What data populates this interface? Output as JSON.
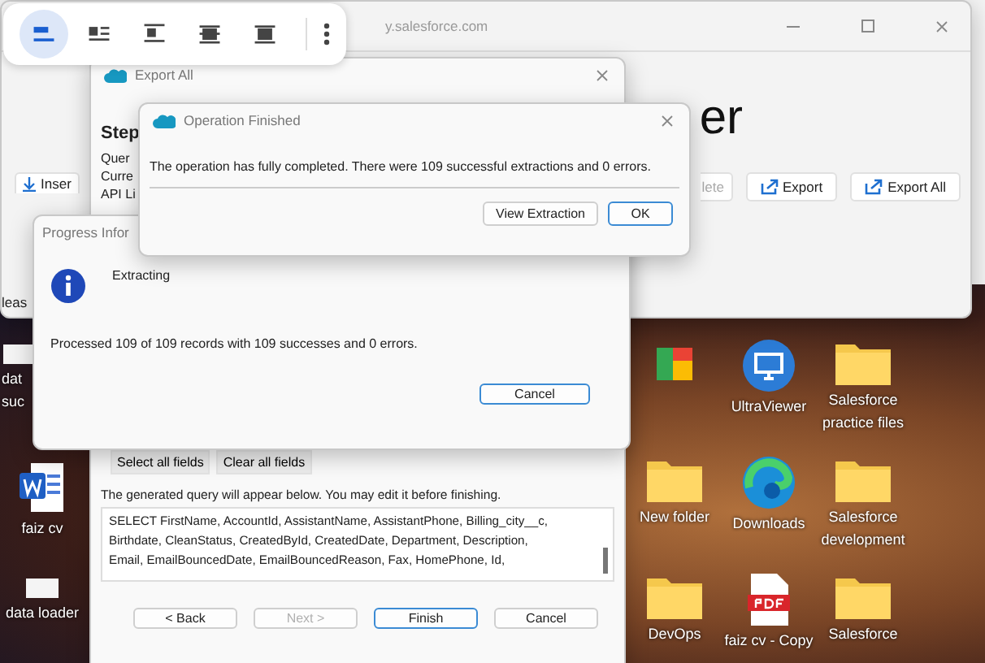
{
  "toolbar": {
    "buttons": [
      {
        "kind": "inline",
        "selected": true
      },
      {
        "kind": "square",
        "selected": false
      },
      {
        "kind": "top-bottom",
        "selected": false
      },
      {
        "kind": "behind",
        "selected": false
      },
      {
        "kind": "front",
        "selected": false
      }
    ]
  },
  "main_window": {
    "url": "y.salesforce.com",
    "heading": "er",
    "left_button": "Inser",
    "note": "leas",
    "buttons": [
      {
        "label": "lete",
        "disabled": true,
        "kind": "plain"
      },
      {
        "label": "Export",
        "disabled": false,
        "kind": "export"
      },
      {
        "label": "Export All",
        "disabled": false,
        "kind": "export"
      }
    ]
  },
  "export_wizard": {
    "title": "Export All",
    "step": "Step",
    "info_lines": [
      "Quer",
      "Curre",
      "API Li"
    ],
    "field_buttons": [
      "Select all fields",
      "Clear all fields"
    ],
    "hint": "The generated query will appear below.  You may edit it before finishing.",
    "query_lines": [
      "SELECT FirstName, AccountId, AssistantName, AssistantPhone, Billing_city__c,",
      "Birthdate, CleanStatus, CreatedById, CreatedDate, Department, Description,",
      "Email, EmailBouncedDate, EmailBouncedReason, Fax, HomePhone, Id,"
    ],
    "nav_buttons": [
      {
        "label": "< Back",
        "disabled": false,
        "default": false
      },
      {
        "label": "Next >",
        "disabled": true,
        "default": false
      },
      {
        "label": "Finish",
        "disabled": false,
        "default": true
      },
      {
        "label": "Cancel",
        "disabled": false,
        "default": false
      }
    ]
  },
  "progress_dialog": {
    "title": "Progress Infor",
    "status": "Extracting",
    "message": "Processed 109 of 109 records with 109 successes and 0 errors.",
    "button": "Cancel"
  },
  "operation_dialog": {
    "title": "Operation Finished",
    "message": "The operation has fully completed.  There were 109 successful extractions and 0 errors.",
    "buttons": [
      {
        "label": "View Extraction",
        "default": false
      },
      {
        "label": "OK",
        "default": true
      }
    ]
  },
  "desktop": {
    "left_icons": [
      {
        "kind": "file",
        "lines": [
          "dat",
          "suc"
        ]
      },
      {
        "kind": "word",
        "lines": [
          "faiz cv"
        ]
      },
      {
        "kind": "file",
        "lines": [
          "data loader"
        ]
      }
    ],
    "right_icons": [
      {
        "kind": "google"
      },
      {
        "kind": "monitor",
        "lines": [
          "UltraViewer"
        ]
      },
      {
        "kind": "folder",
        "lines": [
          "Salesforce",
          "practice files"
        ]
      },
      {
        "kind": "folder",
        "lines": [
          "New folder"
        ]
      },
      {
        "kind": "edge",
        "lines": [
          "Downloads"
        ]
      },
      {
        "kind": "folder",
        "lines": [
          "Salesforce",
          "development"
        ]
      },
      {
        "kind": "folder",
        "lines": [
          "DevOps"
        ]
      },
      {
        "kind": "pdf",
        "lines": [
          "faiz cv - Copy"
        ]
      },
      {
        "kind": "folder",
        "lines": [
          "Salesforce"
        ]
      }
    ]
  }
}
